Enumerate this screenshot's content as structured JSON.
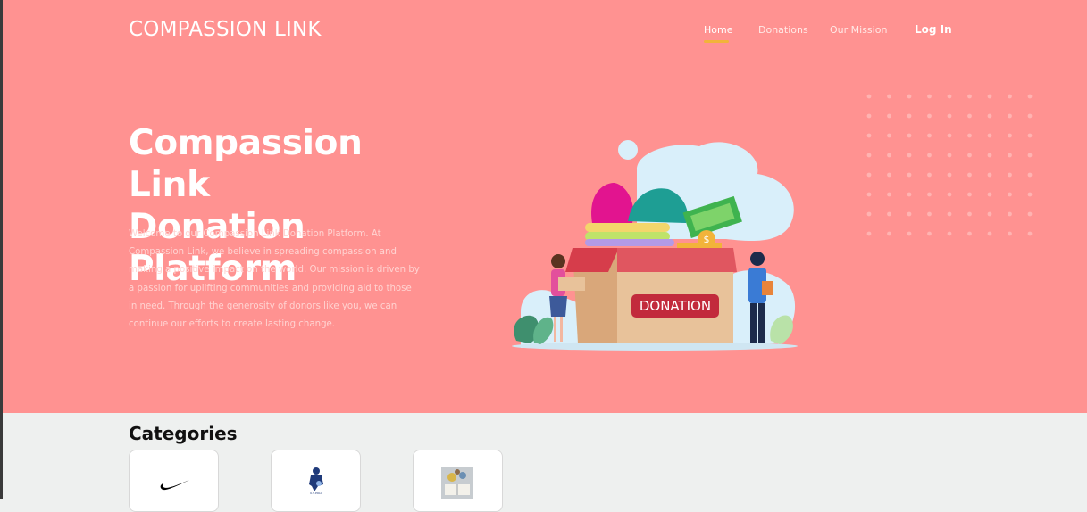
{
  "brand": {
    "name": "COMPASSION LINK"
  },
  "nav": {
    "items": [
      {
        "label": "Home",
        "active": true
      },
      {
        "label": "Donations",
        "active": false
      },
      {
        "label": "Our Mission",
        "active": false
      }
    ],
    "login_label": "Log In"
  },
  "hero": {
    "title_line1": "Compassion Link",
    "title_line2": "Donation Platform",
    "description": "Welcome to our Compassion Link Donation Platform. At Compassion Link, we believe in spreading compassion and making a positive impact on the world. Our mission is driven by a passion for uplifting communities and providing aid to those in need. Through the generosity of donors like you, we can continue our efforts to create lasting change.",
    "illustration": {
      "box_label": "DONATION",
      "coin_symbol": "$"
    }
  },
  "categories": {
    "title": "Categories",
    "items": [
      {
        "icon": "nike-swoosh-icon"
      },
      {
        "icon": "polo-horse-logo-icon"
      },
      {
        "icon": "book-image-icon"
      }
    ]
  },
  "colors": {
    "hero_bg": "#ff9291",
    "accent": "#f2b33a",
    "page_bg": "#eef0ef"
  }
}
